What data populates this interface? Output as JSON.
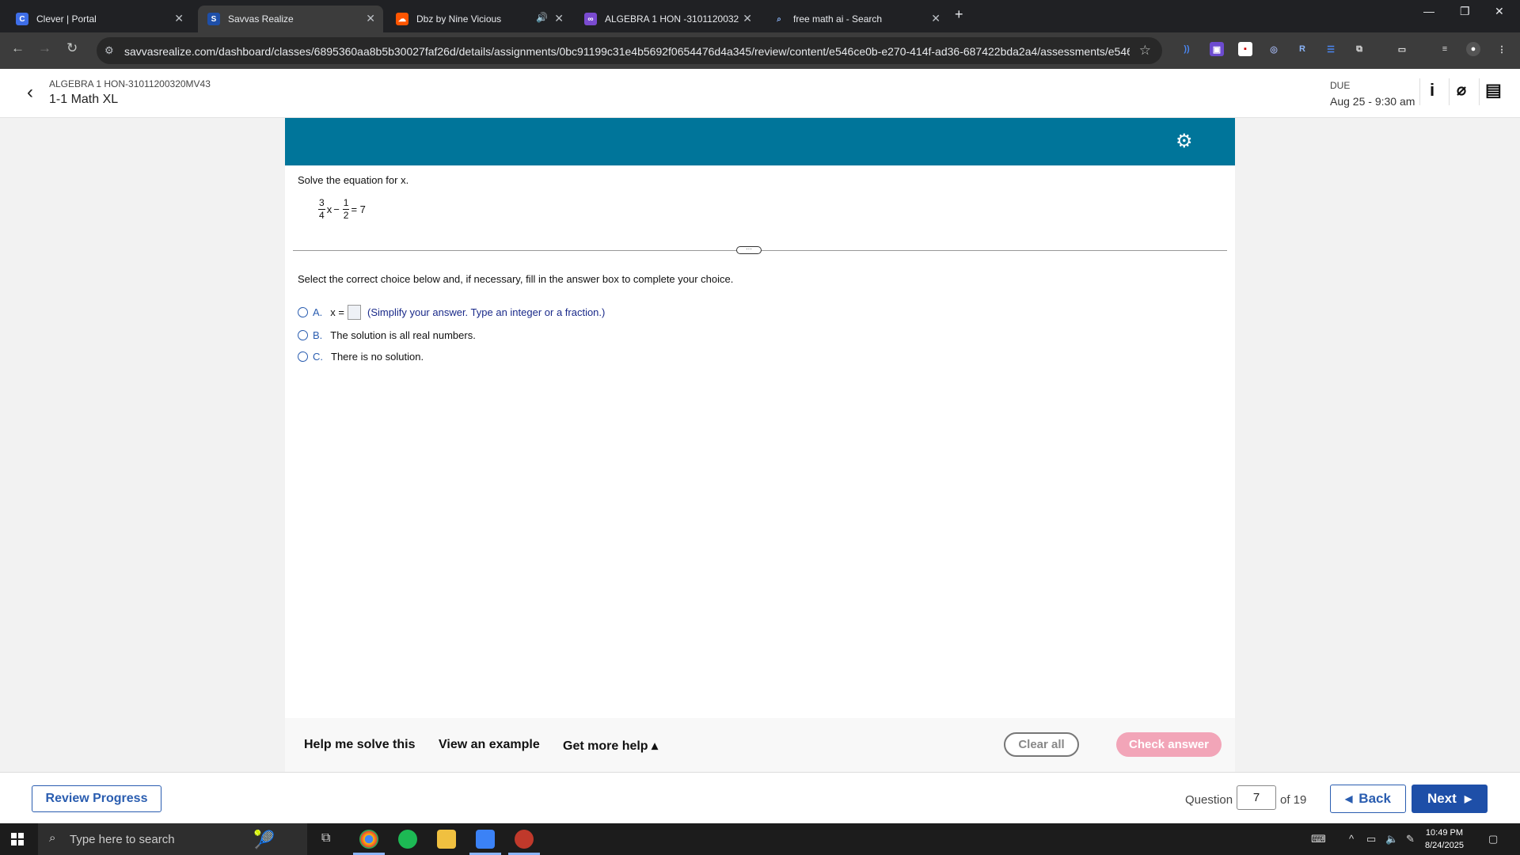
{
  "browser": {
    "tabs": [
      {
        "title": "Clever | Portal",
        "icon": "clever-icon"
      },
      {
        "title": "Savvas Realize",
        "icon": "savvas-icon"
      },
      {
        "title": "Dbz by Nine Vicious",
        "icon": "soundcloud-icon"
      },
      {
        "title": "ALGEBRA 1 HON -3101120032",
        "icon": "mathxl-icon"
      },
      {
        "title": "free math ai - Search",
        "icon": "search-icon"
      }
    ],
    "url": "savvasrealize.com/dashboard/classes/6895360aa8b5b30027faf26d/details/assignments/0bc91199c31e4b5692f0654476d4a345/review/content/e546ce0b-e270-414f-ad36-687422bda2a4/assessments/e546..."
  },
  "header": {
    "course": "ALGEBRA 1 HON-31011200320MV43",
    "assignment": "1-1 Math XL",
    "due_label": "DUE",
    "due_date": "Aug 25 - 9:30 am"
  },
  "question": {
    "prompt": "Solve the equation for x.",
    "equation": {
      "frac1_num": "3",
      "frac1_den": "4",
      "var": "x",
      "op": "−",
      "frac2_num": "1",
      "frac2_den": "2",
      "rhs": "= 7"
    },
    "instruction": "Select the correct choice below and, if necessary, fill in the answer box to complete your choice.",
    "choices": [
      {
        "letter": "A.",
        "prefix": "x =",
        "hint": "(Simplify your answer. Type an integer or a fraction.)"
      },
      {
        "letter": "B.",
        "text": "The solution is all real numbers."
      },
      {
        "letter": "C.",
        "text": "There is no solution."
      }
    ]
  },
  "help": {
    "help_me": "Help me solve this",
    "example": "View an example",
    "more": "Get more help ▴",
    "clear": "Clear all",
    "check": "Check answer"
  },
  "footer": {
    "review": "Review Progress",
    "question_label": "Question",
    "question_number": "7",
    "of_total": "of 19",
    "back": "Back",
    "next": "Next"
  },
  "taskbar": {
    "search_placeholder": "Type here to search",
    "time": "10:49 PM",
    "date": "8/24/2025"
  },
  "colors": {
    "accent": "#00759a",
    "link_blue": "#2a5db0",
    "check_answer_disabled": "#f2a5b8"
  }
}
